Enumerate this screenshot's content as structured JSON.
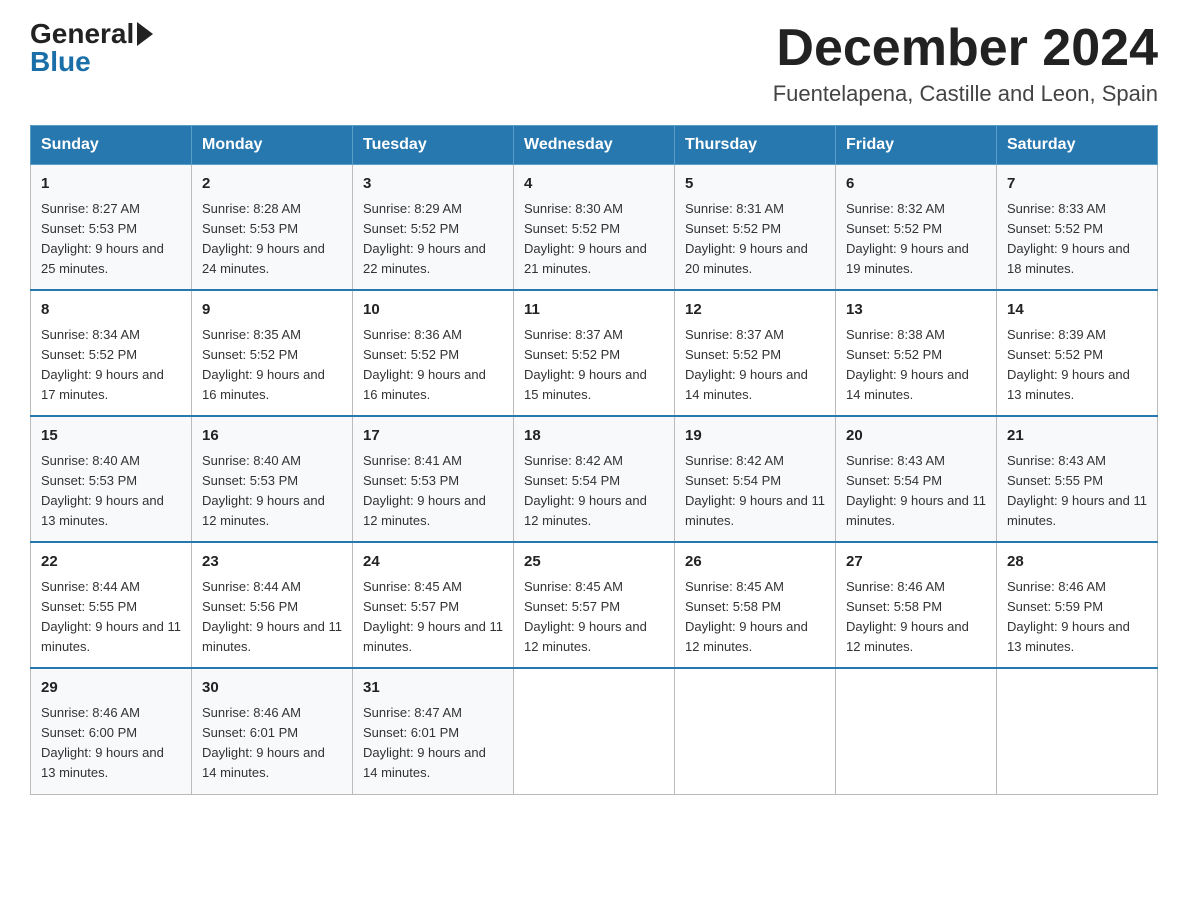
{
  "header": {
    "logo_general": "General",
    "logo_blue": "Blue",
    "month_title": "December 2024",
    "location": "Fuentelapena, Castille and Leon, Spain"
  },
  "days_of_week": [
    "Sunday",
    "Monday",
    "Tuesday",
    "Wednesday",
    "Thursday",
    "Friday",
    "Saturday"
  ],
  "weeks": [
    [
      {
        "day": "1",
        "sunrise": "8:27 AM",
        "sunset": "5:53 PM",
        "daylight": "9 hours and 25 minutes."
      },
      {
        "day": "2",
        "sunrise": "8:28 AM",
        "sunset": "5:53 PM",
        "daylight": "9 hours and 24 minutes."
      },
      {
        "day": "3",
        "sunrise": "8:29 AM",
        "sunset": "5:52 PM",
        "daylight": "9 hours and 22 minutes."
      },
      {
        "day": "4",
        "sunrise": "8:30 AM",
        "sunset": "5:52 PM",
        "daylight": "9 hours and 21 minutes."
      },
      {
        "day": "5",
        "sunrise": "8:31 AM",
        "sunset": "5:52 PM",
        "daylight": "9 hours and 20 minutes."
      },
      {
        "day": "6",
        "sunrise": "8:32 AM",
        "sunset": "5:52 PM",
        "daylight": "9 hours and 19 minutes."
      },
      {
        "day": "7",
        "sunrise": "8:33 AM",
        "sunset": "5:52 PM",
        "daylight": "9 hours and 18 minutes."
      }
    ],
    [
      {
        "day": "8",
        "sunrise": "8:34 AM",
        "sunset": "5:52 PM",
        "daylight": "9 hours and 17 minutes."
      },
      {
        "day": "9",
        "sunrise": "8:35 AM",
        "sunset": "5:52 PM",
        "daylight": "9 hours and 16 minutes."
      },
      {
        "day": "10",
        "sunrise": "8:36 AM",
        "sunset": "5:52 PM",
        "daylight": "9 hours and 16 minutes."
      },
      {
        "day": "11",
        "sunrise": "8:37 AM",
        "sunset": "5:52 PM",
        "daylight": "9 hours and 15 minutes."
      },
      {
        "day": "12",
        "sunrise": "8:37 AM",
        "sunset": "5:52 PM",
        "daylight": "9 hours and 14 minutes."
      },
      {
        "day": "13",
        "sunrise": "8:38 AM",
        "sunset": "5:52 PM",
        "daylight": "9 hours and 14 minutes."
      },
      {
        "day": "14",
        "sunrise": "8:39 AM",
        "sunset": "5:52 PM",
        "daylight": "9 hours and 13 minutes."
      }
    ],
    [
      {
        "day": "15",
        "sunrise": "8:40 AM",
        "sunset": "5:53 PM",
        "daylight": "9 hours and 13 minutes."
      },
      {
        "day": "16",
        "sunrise": "8:40 AM",
        "sunset": "5:53 PM",
        "daylight": "9 hours and 12 minutes."
      },
      {
        "day": "17",
        "sunrise": "8:41 AM",
        "sunset": "5:53 PM",
        "daylight": "9 hours and 12 minutes."
      },
      {
        "day": "18",
        "sunrise": "8:42 AM",
        "sunset": "5:54 PM",
        "daylight": "9 hours and 12 minutes."
      },
      {
        "day": "19",
        "sunrise": "8:42 AM",
        "sunset": "5:54 PM",
        "daylight": "9 hours and 11 minutes."
      },
      {
        "day": "20",
        "sunrise": "8:43 AM",
        "sunset": "5:54 PM",
        "daylight": "9 hours and 11 minutes."
      },
      {
        "day": "21",
        "sunrise": "8:43 AM",
        "sunset": "5:55 PM",
        "daylight": "9 hours and 11 minutes."
      }
    ],
    [
      {
        "day": "22",
        "sunrise": "8:44 AM",
        "sunset": "5:55 PM",
        "daylight": "9 hours and 11 minutes."
      },
      {
        "day": "23",
        "sunrise": "8:44 AM",
        "sunset": "5:56 PM",
        "daylight": "9 hours and 11 minutes."
      },
      {
        "day": "24",
        "sunrise": "8:45 AM",
        "sunset": "5:57 PM",
        "daylight": "9 hours and 11 minutes."
      },
      {
        "day": "25",
        "sunrise": "8:45 AM",
        "sunset": "5:57 PM",
        "daylight": "9 hours and 12 minutes."
      },
      {
        "day": "26",
        "sunrise": "8:45 AM",
        "sunset": "5:58 PM",
        "daylight": "9 hours and 12 minutes."
      },
      {
        "day": "27",
        "sunrise": "8:46 AM",
        "sunset": "5:58 PM",
        "daylight": "9 hours and 12 minutes."
      },
      {
        "day": "28",
        "sunrise": "8:46 AM",
        "sunset": "5:59 PM",
        "daylight": "9 hours and 13 minutes."
      }
    ],
    [
      {
        "day": "29",
        "sunrise": "8:46 AM",
        "sunset": "6:00 PM",
        "daylight": "9 hours and 13 minutes."
      },
      {
        "day": "30",
        "sunrise": "8:46 AM",
        "sunset": "6:01 PM",
        "daylight": "9 hours and 14 minutes."
      },
      {
        "day": "31",
        "sunrise": "8:47 AM",
        "sunset": "6:01 PM",
        "daylight": "9 hours and 14 minutes."
      },
      null,
      null,
      null,
      null
    ]
  ],
  "labels": {
    "sunrise_prefix": "Sunrise: ",
    "sunset_prefix": "Sunset: ",
    "daylight_prefix": "Daylight: "
  }
}
